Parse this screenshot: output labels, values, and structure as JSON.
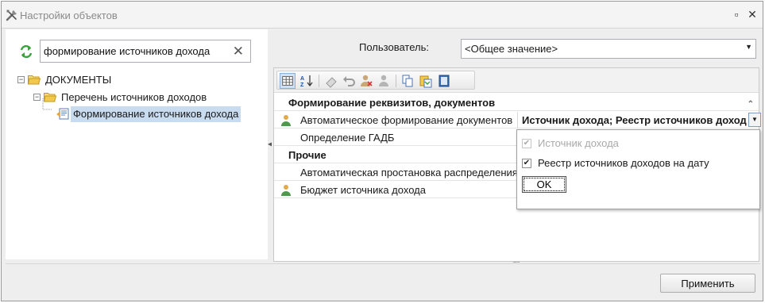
{
  "window": {
    "title": "Настройки объектов",
    "restore_glyph": "▫",
    "close_glyph": "✕"
  },
  "left": {
    "search_value": "формирование источников дохода",
    "clear_glyph": "✕",
    "tree": [
      {
        "label": "ДОКУМЕНТЫ",
        "expander": "−"
      },
      {
        "label": "Перечень источников доходов",
        "expander": "−"
      },
      {
        "label": "Формирование источников дохода",
        "selected": true
      }
    ]
  },
  "right": {
    "user_label": "Пользователь:",
    "user_value": "<Общее значение>",
    "user_arrow": "▼",
    "toolbar_icons": [
      "grid-view-icon",
      "sort-az-icon",
      "eraser-icon",
      "undo-icon",
      "user-remove-icon",
      "user-icon",
      "copy-icon",
      "paste-icon",
      "book-icon"
    ],
    "categories": {
      "cat1": "Формирование реквизитов, документов",
      "cat2": "Прочие"
    },
    "rows": {
      "auto_forming": "Автоматическое формирование документов",
      "auto_forming_value": "Источник дохода; Реестр источников доход",
      "gadb": "Определение ГАДБ",
      "auto_dist": "Автоматическая простановка распределения",
      "budget": "Бюджет источника дохода"
    },
    "dropdown_glyph": "▼",
    "collapse_glyph": "⌃",
    "grip": "......."
  },
  "popup": {
    "options": [
      {
        "label": "Источник дохода",
        "checked": true,
        "disabled": true
      },
      {
        "label": "Реестр источников доходов на дату",
        "checked": true,
        "disabled": false
      }
    ],
    "check_glyph": "✔",
    "ok_label": "OK"
  },
  "footer": {
    "apply_label": "Применить"
  },
  "colors": {
    "selection": "#c8dbef",
    "folder": "#f2c94c",
    "refresh": "#3aa13a",
    "person": "#e0a94b"
  }
}
